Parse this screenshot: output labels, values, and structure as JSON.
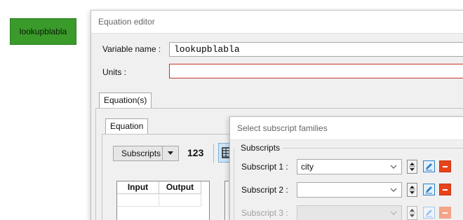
{
  "variable_node": {
    "label": "lookupblabla",
    "color": "#3a9a2a"
  },
  "editor": {
    "title": "Equation editor",
    "variable_name_label": "Variable name :",
    "variable_name_value": "lookupblabla",
    "units_label": "Units :",
    "units_value": "",
    "outer_tab": "Equation(s)",
    "inner_tab": "Equation",
    "subscripts_button": "Subscripts",
    "numeric_label": "123",
    "table": {
      "headers": [
        "Input",
        "Output"
      ]
    }
  },
  "dialog": {
    "title": "Select subscript families",
    "group_label": "Subscripts",
    "rows": [
      {
        "label": "Subscript 1 :",
        "value": "city",
        "enabled": true
      },
      {
        "label": "Subscript 2 :",
        "value": "",
        "enabled": true
      },
      {
        "label": "Subscript 3 :",
        "value": "",
        "enabled": false
      }
    ]
  },
  "colors": {
    "error_border": "#c0392b",
    "delete": "#e8431b",
    "edit": "#2f80c5"
  }
}
